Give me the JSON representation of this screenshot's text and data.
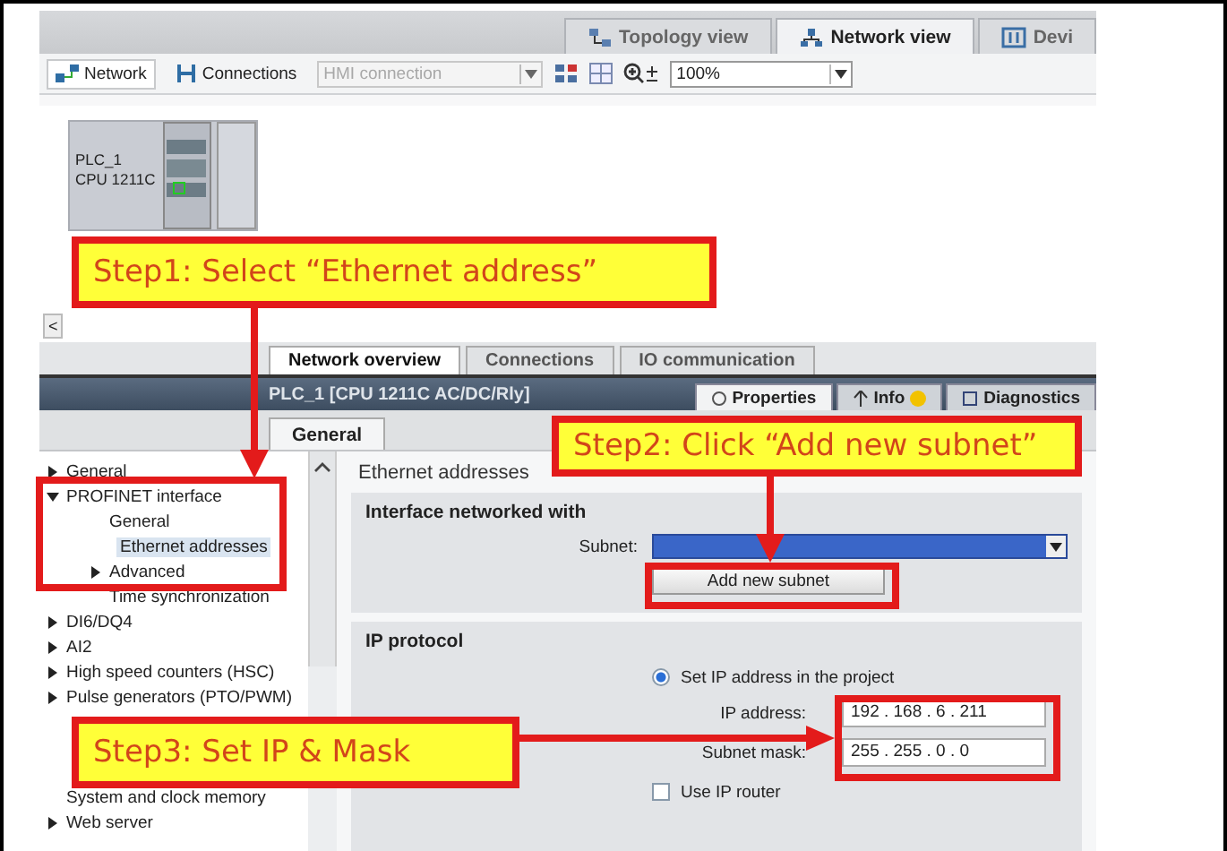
{
  "view_tabs": [
    {
      "label": "Topology view",
      "selected": false
    },
    {
      "label": "Network view",
      "selected": true
    },
    {
      "label": "Devi",
      "selected": false
    }
  ],
  "toolbar": {
    "network_button": "Network",
    "connections_button": "Connections",
    "connection_type": {
      "value": "HMI connection",
      "disabled": true
    },
    "zoom": {
      "value": "100%"
    }
  },
  "canvas": {
    "device": {
      "name": "PLC_1",
      "type": "CPU 1211C"
    },
    "scroll_button": "<"
  },
  "bottom_tabs": [
    {
      "label": "Network overview",
      "selected": true
    },
    {
      "label": "Connections",
      "selected": false
    },
    {
      "label": "IO communication",
      "selected": false
    }
  ],
  "inspector": {
    "title": "PLC_1 [CPU 1211C AC/DC/Rly]",
    "tabs": [
      {
        "label": "Properties",
        "selected": true
      },
      {
        "label": "Info",
        "selected": false
      },
      {
        "label": "Diagnostics",
        "selected": false
      }
    ],
    "general_tab": {
      "label": "General",
      "selected": true
    }
  },
  "sidebar": {
    "items": [
      {
        "label": "General",
        "expanded": false,
        "selected": false
      },
      {
        "label": "PROFINET interface",
        "expanded": true,
        "selected": false,
        "children": [
          {
            "label": "General",
            "selected": false
          },
          {
            "label": "Ethernet addresses",
            "selected": true
          },
          {
            "label": "Advanced",
            "expanded": false,
            "selected": false
          },
          {
            "label": "Time synchronization",
            "selected": false
          }
        ]
      },
      {
        "label": "DI6/DQ4",
        "expanded": false,
        "selected": false
      },
      {
        "label": "AI2",
        "expanded": false,
        "selected": false
      },
      {
        "label": "High speed counters (HSC)",
        "expanded": false,
        "selected": false
      },
      {
        "label": "Pulse generators (PTO/PWM)",
        "expanded": false,
        "selected": false
      },
      {
        "label": "System and clock memory",
        "selected": false
      },
      {
        "label": "Web server",
        "expanded": false,
        "selected": false
      }
    ]
  },
  "content": {
    "heading": "Ethernet addresses",
    "interface_section": {
      "title": "Interface networked with",
      "subnet_label": "Subnet:",
      "add_button": "Add new subnet"
    },
    "ip_section": {
      "title": "IP protocol",
      "option": {
        "label": "Set IP address in the project",
        "selected": true
      },
      "ip_label": "IP address:",
      "ip_value": "192 . 168 . 6 . 211",
      "mask_label": "Subnet mask:",
      "mask_value": "255 . 255 . 0 . 0",
      "router": {
        "label": "Use IP router",
        "checked": false
      }
    }
  },
  "callouts": [
    {
      "text": "Step1: Select “Ethernet address”"
    },
    {
      "text": "Step2: Click “Add new subnet”"
    },
    {
      "text": "Step3: Set IP & Mask"
    }
  ]
}
